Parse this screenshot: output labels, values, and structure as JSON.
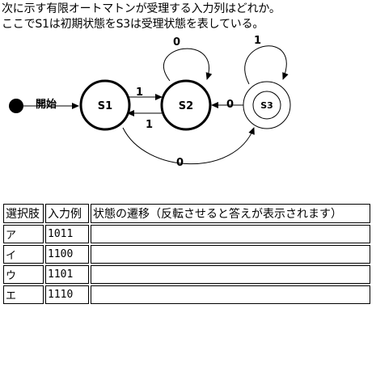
{
  "question": {
    "line1": "次に示す有限オートマトンが受理する入力列はどれか。",
    "line2": "ここでS1は初期状態をS3は受理状態を表している。"
  },
  "diagram": {
    "start_label": "開始",
    "states": {
      "s1": "S1",
      "s2": "S2",
      "s3": "S3"
    },
    "transitions": {
      "s1_to_s2": "1",
      "s2_to_s1": "1",
      "s2_self": "0",
      "s3_self": "1",
      "s3_to_s2": "0",
      "s1_to_s3": "0"
    }
  },
  "table": {
    "headers": {
      "choice": "選択肢",
      "input": "入力例",
      "transition": "状態の遷移（反転させると答えが表示されます）"
    },
    "rows": [
      {
        "choice": "ア",
        "input": "1011",
        "transition": ""
      },
      {
        "choice": "イ",
        "input": "1100",
        "transition": ""
      },
      {
        "choice": "ウ",
        "input": "1101",
        "transition": ""
      },
      {
        "choice": "エ",
        "input": "1110",
        "transition": ""
      }
    ]
  }
}
